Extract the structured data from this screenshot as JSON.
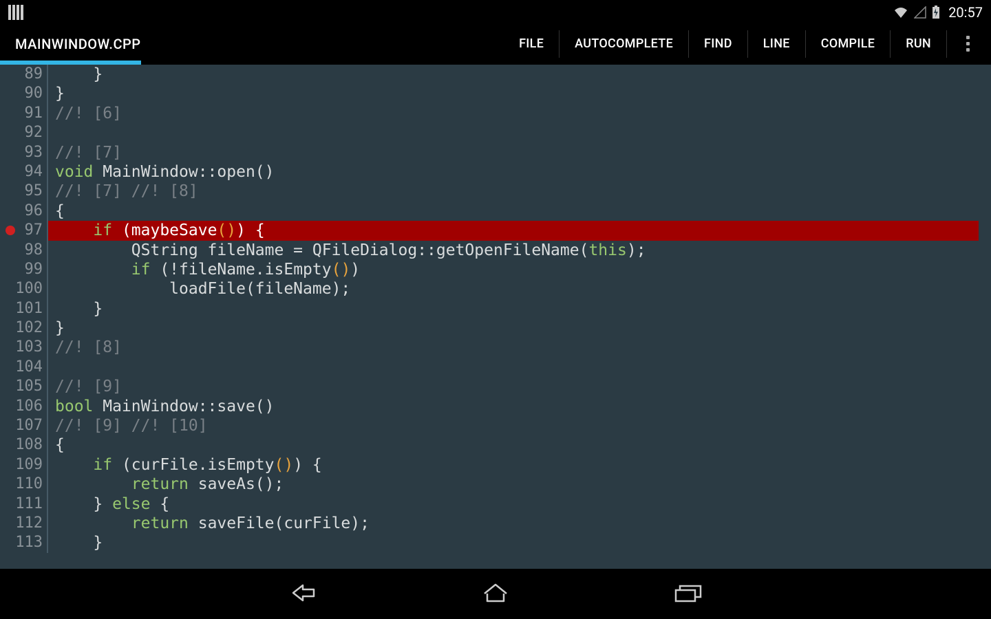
{
  "status": {
    "clock": "20:57"
  },
  "toolbar": {
    "title": "MAINWINDOW.CPP",
    "menus": {
      "file": "FILE",
      "autocomplete": "AUTOCOMPLETE",
      "find": "FIND",
      "line": "LINE",
      "compile": "COMPILE",
      "run": "RUN"
    }
  },
  "editor": {
    "highlighted_line": 97,
    "breakpoint_line": 97,
    "lines": [
      {
        "n": 89,
        "tokens": [
          {
            "t": "    }",
            "c": ""
          }
        ]
      },
      {
        "n": 90,
        "tokens": [
          {
            "t": "}",
            "c": ""
          }
        ]
      },
      {
        "n": 91,
        "tokens": [
          {
            "t": "//! [6]",
            "c": "cm"
          }
        ]
      },
      {
        "n": 92,
        "tokens": [
          {
            "t": "",
            "c": ""
          }
        ]
      },
      {
        "n": 93,
        "tokens": [
          {
            "t": "//! [7]",
            "c": "cm"
          }
        ]
      },
      {
        "n": 94,
        "tokens": [
          {
            "t": "void",
            "c": "kw"
          },
          {
            "t": " MainWindow::open()",
            "c": ""
          }
        ]
      },
      {
        "n": 95,
        "tokens": [
          {
            "t": "//! [7] //! [8]",
            "c": "cm"
          }
        ]
      },
      {
        "n": 96,
        "tokens": [
          {
            "t": "{",
            "c": ""
          }
        ]
      },
      {
        "n": 97,
        "tokens": [
          {
            "t": "    ",
            "c": ""
          },
          {
            "t": "if",
            "c": "kw"
          },
          {
            "t": " (maybeSave",
            "c": ""
          },
          {
            "t": "()",
            "c": "paren-lit"
          },
          {
            "t": ") {",
            "c": ""
          }
        ]
      },
      {
        "n": 98,
        "tokens": [
          {
            "t": "        QString fileName = QFileDialog::getOpenFileName(",
            "c": ""
          },
          {
            "t": "this",
            "c": "kw"
          },
          {
            "t": ");",
            "c": ""
          }
        ]
      },
      {
        "n": 99,
        "tokens": [
          {
            "t": "        ",
            "c": ""
          },
          {
            "t": "if",
            "c": "kw"
          },
          {
            "t": " (!fileName.isEmpty",
            "c": ""
          },
          {
            "t": "()",
            "c": "paren-lit"
          },
          {
            "t": ")",
            "c": ""
          }
        ]
      },
      {
        "n": 100,
        "tokens": [
          {
            "t": "            loadFile(fileName);",
            "c": ""
          }
        ]
      },
      {
        "n": 101,
        "tokens": [
          {
            "t": "    }",
            "c": ""
          }
        ]
      },
      {
        "n": 102,
        "tokens": [
          {
            "t": "}",
            "c": ""
          }
        ]
      },
      {
        "n": 103,
        "tokens": [
          {
            "t": "//! [8]",
            "c": "cm"
          }
        ]
      },
      {
        "n": 104,
        "tokens": [
          {
            "t": "",
            "c": ""
          }
        ]
      },
      {
        "n": 105,
        "tokens": [
          {
            "t": "//! [9]",
            "c": "cm"
          }
        ]
      },
      {
        "n": 106,
        "tokens": [
          {
            "t": "bool",
            "c": "kw"
          },
          {
            "t": " MainWindow::save()",
            "c": ""
          }
        ]
      },
      {
        "n": 107,
        "tokens": [
          {
            "t": "//! [9] //! [10]",
            "c": "cm"
          }
        ]
      },
      {
        "n": 108,
        "tokens": [
          {
            "t": "{",
            "c": ""
          }
        ]
      },
      {
        "n": 109,
        "tokens": [
          {
            "t": "    ",
            "c": ""
          },
          {
            "t": "if",
            "c": "kw"
          },
          {
            "t": " (curFile.isEmpty",
            "c": ""
          },
          {
            "t": "()",
            "c": "paren-lit"
          },
          {
            "t": ") {",
            "c": ""
          }
        ]
      },
      {
        "n": 110,
        "tokens": [
          {
            "t": "        ",
            "c": ""
          },
          {
            "t": "return",
            "c": "kw"
          },
          {
            "t": " saveAs();",
            "c": ""
          }
        ]
      },
      {
        "n": 111,
        "tokens": [
          {
            "t": "    } ",
            "c": ""
          },
          {
            "t": "else",
            "c": "kw"
          },
          {
            "t": " {",
            "c": ""
          }
        ]
      },
      {
        "n": 112,
        "tokens": [
          {
            "t": "        ",
            "c": ""
          },
          {
            "t": "return",
            "c": "kw"
          },
          {
            "t": " saveFile(curFile);",
            "c": ""
          }
        ]
      },
      {
        "n": 113,
        "tokens": [
          {
            "t": "    }",
            "c": ""
          }
        ]
      }
    ]
  }
}
